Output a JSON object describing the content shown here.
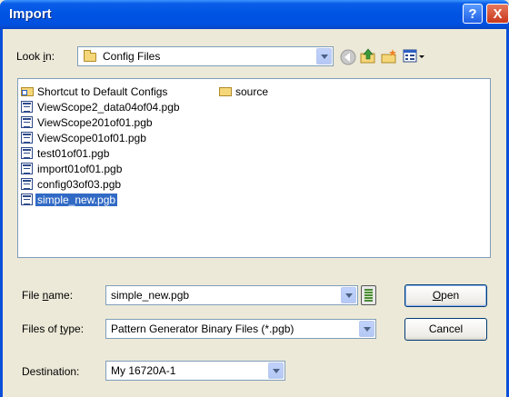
{
  "title": "Import",
  "title_buttons": {
    "help": "?",
    "close": "X"
  },
  "look_in": {
    "label_pre": "Look ",
    "label_key": "i",
    "label_post": "n:",
    "value": "Config Files"
  },
  "toolbar_icons": [
    "back-icon",
    "up-folder-icon",
    "new-folder-icon",
    "view-menu-icon"
  ],
  "files": [
    {
      "name": "Shortcut to Default Configs",
      "kind": "folder-shortcut"
    },
    {
      "name": "source",
      "kind": "folder"
    },
    {
      "name": "ViewScope2_data04of04.pgb",
      "kind": "file"
    },
    {
      "name": "ViewScope201of01.pgb",
      "kind": "file"
    },
    {
      "name": "ViewScope01of01.pgb",
      "kind": "file"
    },
    {
      "name": "test01of01.pgb",
      "kind": "file"
    },
    {
      "name": "import01of01.pgb",
      "kind": "file"
    },
    {
      "name": "config03of03.pgb",
      "kind": "file"
    },
    {
      "name": "simple_new.pgb",
      "kind": "file",
      "selected": true
    }
  ],
  "file_name": {
    "label_pre": "File ",
    "label_key": "n",
    "label_post": "ame:",
    "value": "simple_new.pgb"
  },
  "file_type": {
    "label_pre": "Files of ",
    "label_key": "t",
    "label_post": "ype:",
    "value": "Pattern Generator Binary Files (*.pgb)"
  },
  "destination": {
    "label": "Destination:",
    "value": "My 16720A-1"
  },
  "buttons": {
    "open_key": "O",
    "open_rest": "pen",
    "cancel": "Cancel"
  }
}
